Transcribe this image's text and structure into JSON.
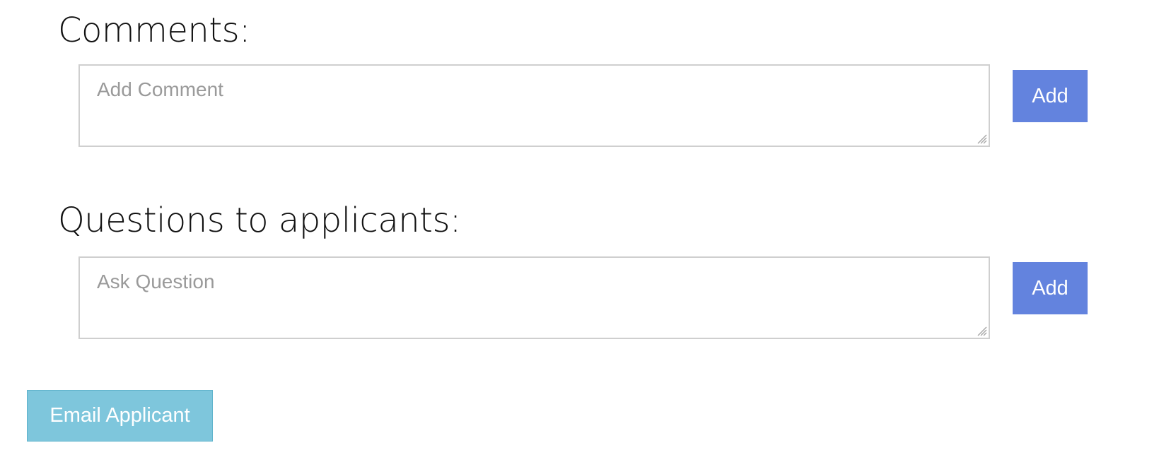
{
  "comments": {
    "heading": "Comments:",
    "placeholder": "Add Comment",
    "value": "",
    "add_label": "Add"
  },
  "questions": {
    "heading": "Questions to applicants:",
    "placeholder": "Ask Question",
    "value": "",
    "add_label": "Add"
  },
  "email_button_label": "Email Applicant",
  "colors": {
    "add_button": "#6383de",
    "email_button": "#7ec6dc",
    "field_border": "#cfcfcf",
    "placeholder_text": "#9a9a9a"
  }
}
